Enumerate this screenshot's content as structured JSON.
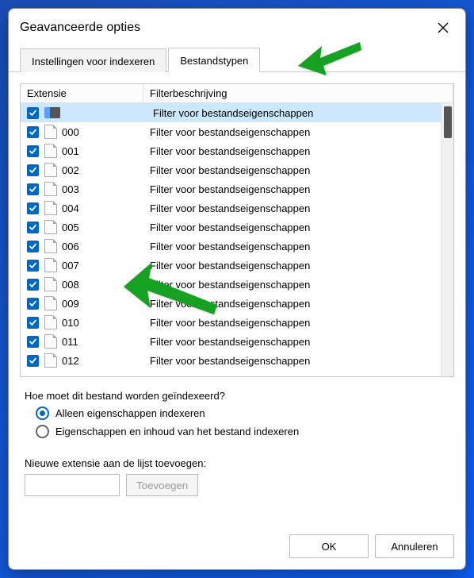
{
  "window": {
    "title": "Geavanceerde opties"
  },
  "tabs": [
    {
      "id": "indexing-settings",
      "label": "Instellingen voor indexeren",
      "active": false
    },
    {
      "id": "file-types",
      "label": "Bestandstypen",
      "active": true
    }
  ],
  "columns": {
    "extension": "Extensie",
    "filter": "Filterbeschrijving"
  },
  "rows": [
    {
      "ext": "",
      "desc": "Filter voor bestandseigenschappen",
      "checked": true,
      "selected": true,
      "specialIcon": true
    },
    {
      "ext": "000",
      "desc": "Filter voor bestandseigenschappen",
      "checked": true
    },
    {
      "ext": "001",
      "desc": "Filter voor bestandseigenschappen",
      "checked": true
    },
    {
      "ext": "002",
      "desc": "Filter voor bestandseigenschappen",
      "checked": true
    },
    {
      "ext": "003",
      "desc": "Filter voor bestandseigenschappen",
      "checked": true
    },
    {
      "ext": "004",
      "desc": "Filter voor bestandseigenschappen",
      "checked": true
    },
    {
      "ext": "005",
      "desc": "Filter voor bestandseigenschappen",
      "checked": true
    },
    {
      "ext": "006",
      "desc": "Filter voor bestandseigenschappen",
      "checked": true
    },
    {
      "ext": "007",
      "desc": "Filter voor bestandseigenschappen",
      "checked": true
    },
    {
      "ext": "008",
      "desc": "Filter voor bestandseigenschappen",
      "checked": true
    },
    {
      "ext": "009",
      "desc": "Filter voor bestandseigenschappen",
      "checked": true
    },
    {
      "ext": "010",
      "desc": "Filter voor bestandseigenschappen",
      "checked": true
    },
    {
      "ext": "011",
      "desc": "Filter voor bestandseigenschappen",
      "checked": true
    },
    {
      "ext": "012",
      "desc": "Filter voor bestandseigenschappen",
      "checked": true
    }
  ],
  "indexing": {
    "question": "Hoe moet dit bestand worden geïndexeerd?",
    "options": [
      {
        "id": "props-only",
        "label": "Alleen eigenschappen indexeren",
        "checked": true
      },
      {
        "id": "props-and-content",
        "label": "Eigenschappen en inhoud van het bestand indexeren",
        "checked": false
      }
    ]
  },
  "add": {
    "label": "Nieuwe extensie aan de lijst toevoegen:",
    "button": "Toevoegen",
    "value": "",
    "placeholder": ""
  },
  "footer": {
    "ok": "OK",
    "cancel": "Annuleren"
  }
}
